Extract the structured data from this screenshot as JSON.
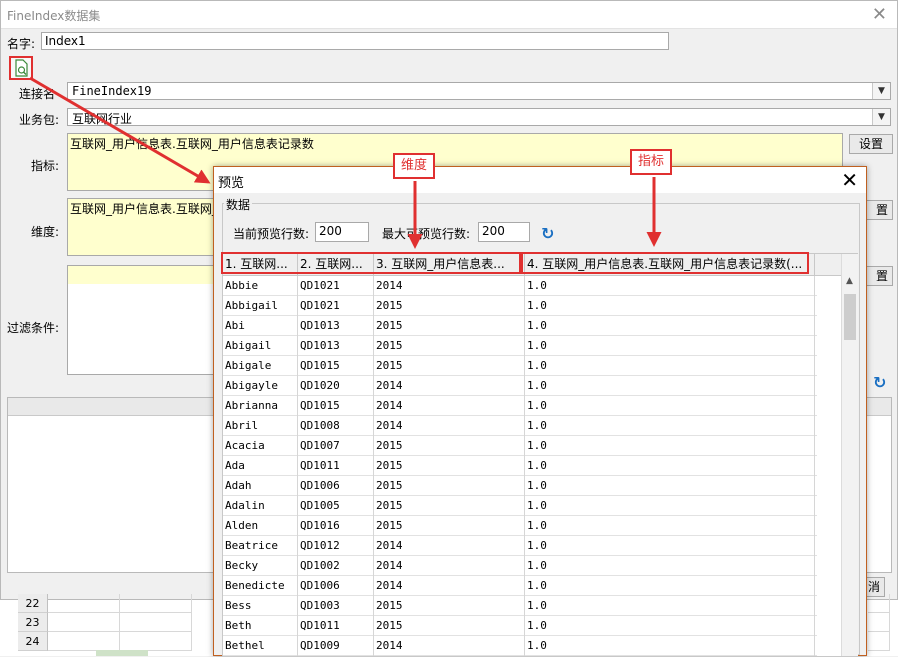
{
  "main_dialog": {
    "title": "FineIndex数据集",
    "name_label": "名字:",
    "name_value": "Index1",
    "connection_label": "连接名",
    "connection_value": "FineIndex19",
    "package_label": "业务包:",
    "package_value": "互联网行业",
    "metric_label": "指标:",
    "metric_value": "互联网_用户信息表.互联网_用户信息表记录数",
    "metric_button": "设置",
    "dimension_label": "维度:",
    "dimension_value": "互联网_用户信息表.互联网_用户信息表",
    "dimension_button": "置",
    "filter_label": "过滤条件:",
    "filter_button": "置",
    "bottom_button": "消"
  },
  "sheet": {
    "rows": [
      "22",
      "23",
      "24"
    ]
  },
  "preview_dialog": {
    "title": "预览",
    "group_label": "数据",
    "current_rows_label": "当前预览行数:",
    "current_rows_value": "200",
    "max_rows_label": "最大可预览行数:",
    "max_rows_value": "200",
    "columns": [
      "1. 互联网...",
      "2. 互联网...",
      "3. 互联网_用户信息表...",
      "4. 互联网_用户信息表.互联网_用户信息表记录数(..."
    ],
    "rows": [
      [
        "Abbie",
        "QD1021",
        "2014",
        "1.0"
      ],
      [
        "Abbigail",
        "QD1021",
        "2015",
        "1.0"
      ],
      [
        "Abi",
        "QD1013",
        "2015",
        "1.0"
      ],
      [
        "Abigail",
        "QD1013",
        "2015",
        "1.0"
      ],
      [
        "Abigale",
        "QD1015",
        "2015",
        "1.0"
      ],
      [
        "Abigayle",
        "QD1020",
        "2014",
        "1.0"
      ],
      [
        "Abrianna",
        "QD1015",
        "2014",
        "1.0"
      ],
      [
        "Abril",
        "QD1008",
        "2014",
        "1.0"
      ],
      [
        "Acacia",
        "QD1007",
        "2015",
        "1.0"
      ],
      [
        "Ada",
        "QD1011",
        "2015",
        "1.0"
      ],
      [
        "Adah",
        "QD1006",
        "2015",
        "1.0"
      ],
      [
        "Adalin",
        "QD1005",
        "2015",
        "1.0"
      ],
      [
        "Alden",
        "QD1016",
        "2015",
        "1.0"
      ],
      [
        "Beatrice",
        "QD1012",
        "2014",
        "1.0"
      ],
      [
        "Becky",
        "QD1002",
        "2014",
        "1.0"
      ],
      [
        "Benedicte",
        "QD1006",
        "2014",
        "1.0"
      ],
      [
        "Bess",
        "QD1003",
        "2015",
        "1.0"
      ],
      [
        "Beth",
        "QD1011",
        "2015",
        "1.0"
      ],
      [
        "Bethel",
        "QD1009",
        "2014",
        "1.0"
      ]
    ]
  },
  "annotations": {
    "dimension": "维度",
    "metric": "指标"
  },
  "colors": {
    "annotation": "#e03030",
    "highlight": "#ffffce",
    "refresh": "#1a6fc2"
  }
}
